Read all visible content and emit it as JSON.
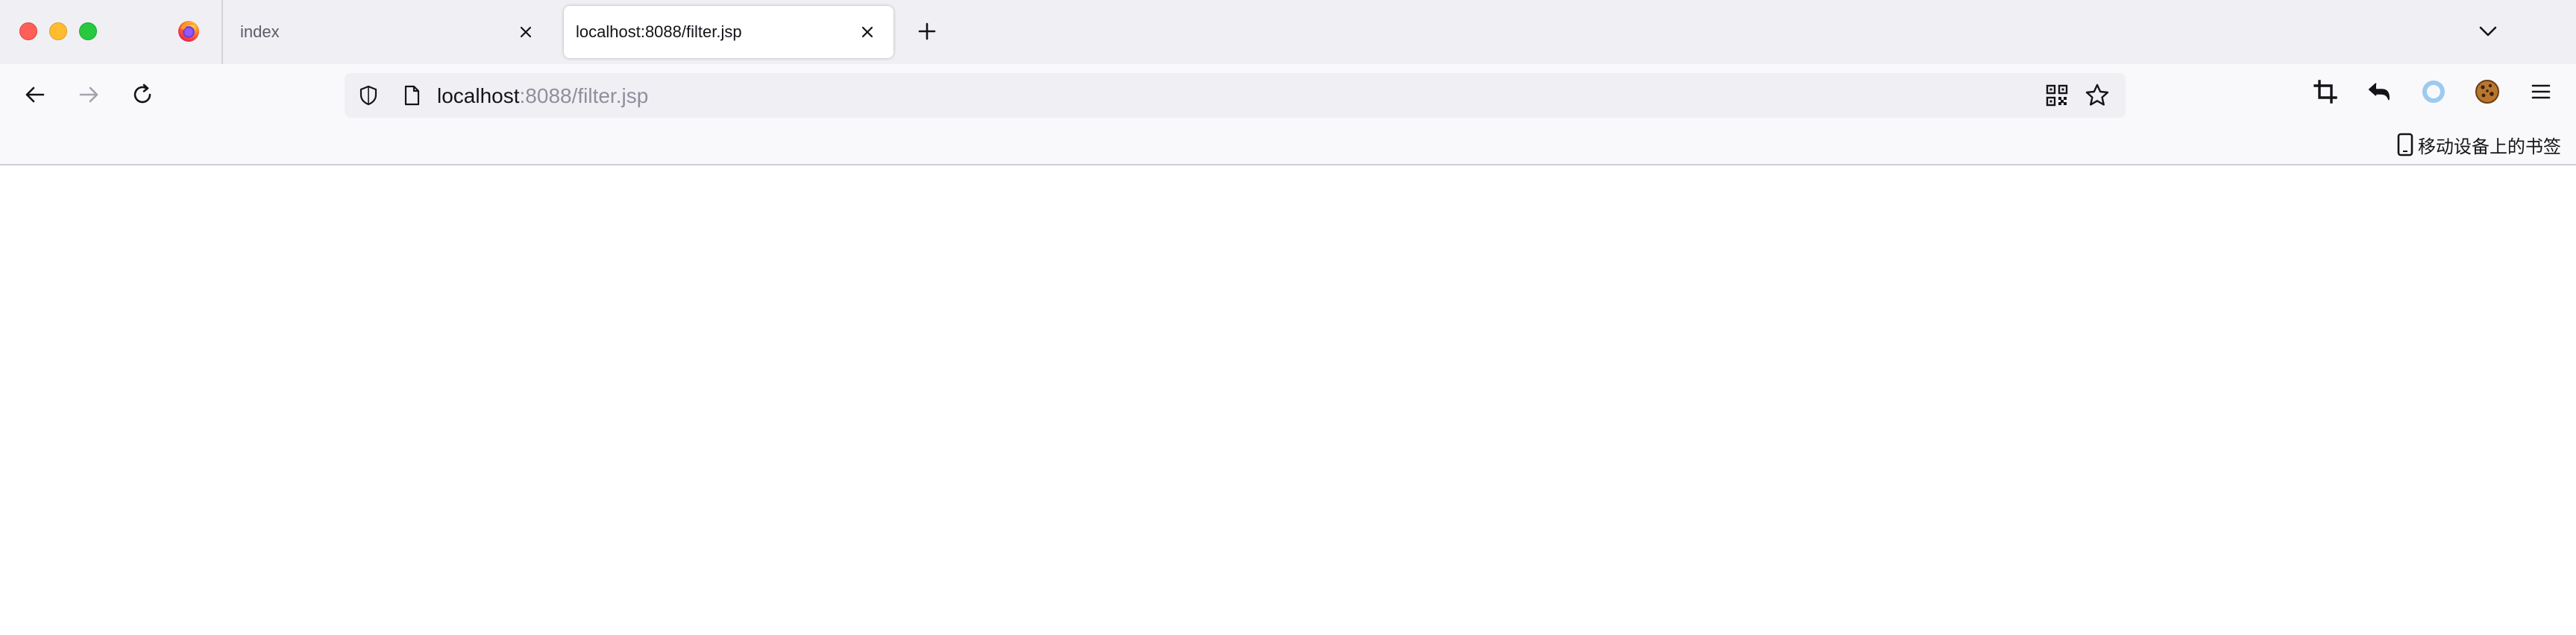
{
  "browser": {
    "tabs": [
      {
        "label": "index",
        "active": false
      },
      {
        "label": "localhost:8088/filter.jsp",
        "active": true
      }
    ]
  },
  "urlbar": {
    "host": "localhost",
    "rest": ":8088/filter.jsp"
  },
  "bookmarks": {
    "mobile_label": "移动设备上的书签"
  },
  "icons": {
    "traffic": [
      "close",
      "minimize",
      "maximize"
    ],
    "nav": [
      "back-icon",
      "forward-icon",
      "reload-icon"
    ],
    "toolbar": [
      "crop-icon",
      "undo-icon",
      "ring-icon",
      "cookie-icon",
      "menu-icon"
    ]
  },
  "colors": {
    "traffic_close": "#ff5f57",
    "traffic_min": "#febc2e",
    "traffic_max": "#28c840",
    "tabstrip_bg": "#f0f0f4",
    "navbar_bg": "#f9f9fb"
  }
}
